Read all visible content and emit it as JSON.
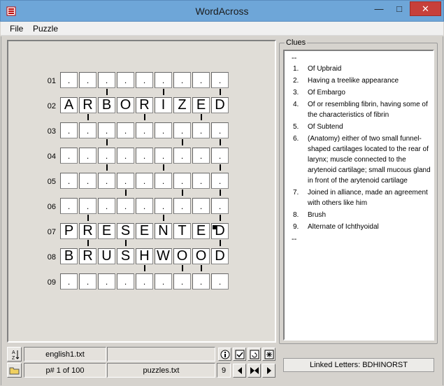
{
  "window": {
    "title": "WordAcross"
  },
  "menu": [
    {
      "label": "File"
    },
    {
      "label": "Puzzle"
    }
  ],
  "board": {
    "rows": [
      {
        "num": "01",
        "word": ".........",
        "links": [
          3,
          6,
          9
        ]
      },
      {
        "num": "02",
        "word": "ARBORIZED",
        "links": [
          2,
          5,
          8
        ]
      },
      {
        "num": "03",
        "word": ".........",
        "links": [
          3,
          7,
          9
        ]
      },
      {
        "num": "04",
        "word": ".........",
        "links": [
          3,
          6,
          9
        ]
      },
      {
        "num": "05",
        "word": ".........",
        "links": [
          4,
          7,
          9
        ]
      },
      {
        "num": "06",
        "word": ".........",
        "links": [
          2,
          6,
          9
        ]
      },
      {
        "num": "07",
        "word": "PRESENTED",
        "links": [
          2,
          4,
          9
        ]
      },
      {
        "num": "08",
        "word": "BRUSHWOOD",
        "links": [
          5,
          7,
          8
        ]
      },
      {
        "num": "09",
        "word": ".........",
        "links": []
      }
    ],
    "selected_row": 6,
    "selected_col": 8
  },
  "clues": {
    "title": "Clues",
    "open_dash": "--",
    "close_dash": "--",
    "items": [
      {
        "num": "1.",
        "text": "Of Upbraid"
      },
      {
        "num": "2.",
        "text": "Having a treelike appearance"
      },
      {
        "num": "3.",
        "text": "Of Embargo"
      },
      {
        "num": "4.",
        "text": "Of or resembling fibrin, having some of the characteristics of fibrin"
      },
      {
        "num": "5.",
        "text": "Of Subtend"
      },
      {
        "num": "6.",
        "text": "(Anatomy) either of two small funnel-shaped cartilages located to the rear of larynx; muscle connected to the arytenoid cartilage; small mucous gland in front of the arytenoid cartilage"
      },
      {
        "num": "7.",
        "text": "Joined in alliance, made an agreement with others like him"
      },
      {
        "num": "8.",
        "text": "Brush"
      },
      {
        "num": "9.",
        "text": "Alternate of Ichthyoidal"
      }
    ]
  },
  "status": {
    "sort_icon_label": "A Z",
    "file": "english1.txt",
    "blank": "",
    "puzzle_pos": "p# 1 of 100",
    "puzzles_file": "puzzles.txt",
    "count": "9",
    "linked_letters": "Linked Letters: BDHINORST"
  }
}
